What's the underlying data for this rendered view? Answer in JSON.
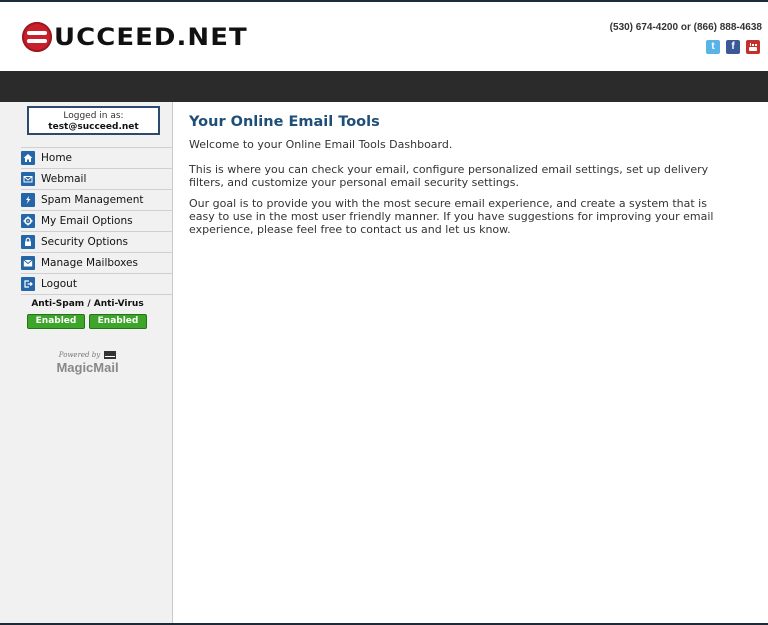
{
  "header": {
    "brand": "UCCEED.NET",
    "phone": "(530) 674-4200 or (866) 888-4638",
    "social": [
      "twitter-icon",
      "facebook-icon",
      "youtube-icon"
    ]
  },
  "sidebar": {
    "logged_in_label": "Logged in as:",
    "username": "test@succeed.net",
    "menu": [
      {
        "label": "Home",
        "icon": "home-icon"
      },
      {
        "label": "Webmail",
        "icon": "mail-icon"
      },
      {
        "label": "Spam Management",
        "icon": "spam-icon"
      },
      {
        "label": "My Email Options",
        "icon": "gear-icon"
      },
      {
        "label": "Security Options",
        "icon": "lock-icon"
      },
      {
        "label": "Manage Mailboxes",
        "icon": "mailboxes-icon"
      },
      {
        "label": "Logout",
        "icon": "logout-icon"
      }
    ],
    "antispam_title": "Anti-Spam / Anti-Virus",
    "antispam_status": "Enabled",
    "antivirus_status": "Enabled",
    "powered_by": "Powered by",
    "powered_brand": "MagicMail"
  },
  "main": {
    "title": "Your Online Email Tools",
    "welcome": "Welcome to your Online Email Tools Dashboard.",
    "paragraph1": "This is where you can check your email, configure personalized email settings, set up delivery filters, and customize your personal email security settings.",
    "paragraph2": "Our goal is to provide you with the most secure email experience, and create a system that is easy to use in the most user friendly manner. If you have suggestions for improving your email experience, please feel free to contact us and let us know."
  },
  "colors": {
    "brand_red": "#c8202a",
    "nav_dark": "#2b2b2b",
    "menu_icon": "#2466a8",
    "title_blue": "#1f4e79",
    "enabled_green": "#3da62a"
  }
}
